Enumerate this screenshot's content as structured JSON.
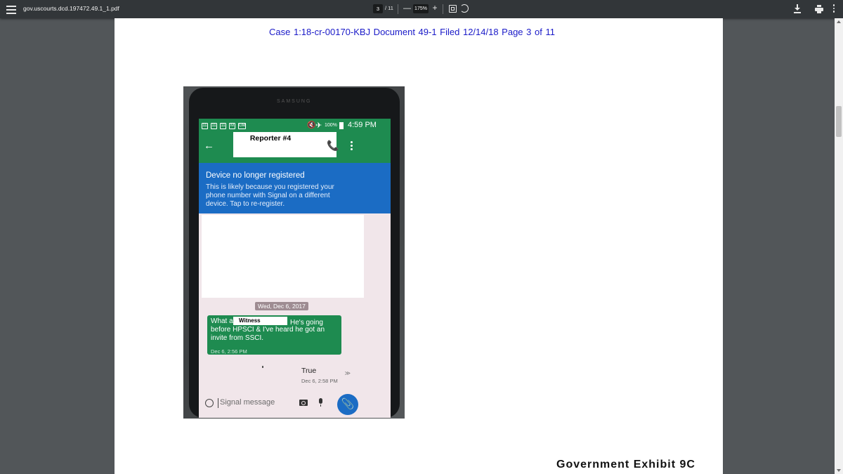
{
  "viewer": {
    "file_title": "gov.uscourts.dcd.197472.49.1_1.pdf",
    "page_current": "3",
    "page_total": "/ 11",
    "zoom_out": "—",
    "zoom_value": "175%",
    "zoom_in": "+"
  },
  "document": {
    "header": "Case 1:18-cr-00170-KBJ   Document 49-1   Filed 12/14/18   Page 3 of 11",
    "exhibit_label": "Government Exhibit 9C"
  },
  "phone": {
    "brand": "SAMSUNG",
    "notif_icons": [
      "11",
      "11",
      "11",
      "M",
      "GM"
    ],
    "battery": "100%",
    "time": "4:59 PM",
    "contact": "Reporter #4",
    "reminder_title": "Device no longer registered",
    "reminder_body": "This is likely because you registered your phone number with Signal on a different device. Tap to re-register.",
    "date_chip": "Wed, Dec 6, 2017",
    "incoming": {
      "part1": "What about",
      "redaction": "Witness",
      "part2": "He's going",
      "part3": "before HPSCI & I've heard he got an invite from SSCI.",
      "time": "Dec 6, 2:56 PM"
    },
    "outgoing": {
      "text": "True",
      "time": "Dec 6, 2:58 PM"
    },
    "compose_placeholder": "Signal message"
  },
  "icons": {
    "back": "←",
    "call": "📞",
    "attach": "📎",
    "delivered": "≫",
    "mute": "🔇",
    "airplane": "✈"
  }
}
